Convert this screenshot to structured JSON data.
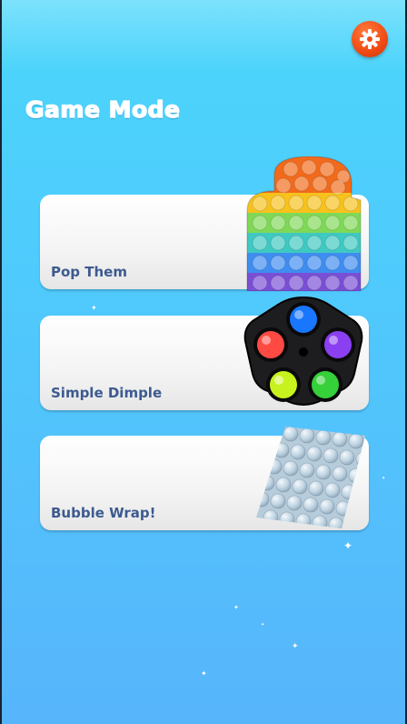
{
  "header": {
    "title": "Game Mode",
    "settings_icon": "gear-icon"
  },
  "modes": [
    {
      "label": "Pop Them",
      "art": "rainbow-popit-mitten"
    },
    {
      "label": "Simple Dimple",
      "art": "simple-dimple-fidget"
    },
    {
      "label": "Bubble Wrap!",
      "art": "bubble-wrap-sheet"
    }
  ],
  "colors": {
    "background_top": "#4ad6fb",
    "background_bottom": "#57b5fb",
    "settings_button": "#f04a14",
    "card_label": "#3d5a8f"
  }
}
